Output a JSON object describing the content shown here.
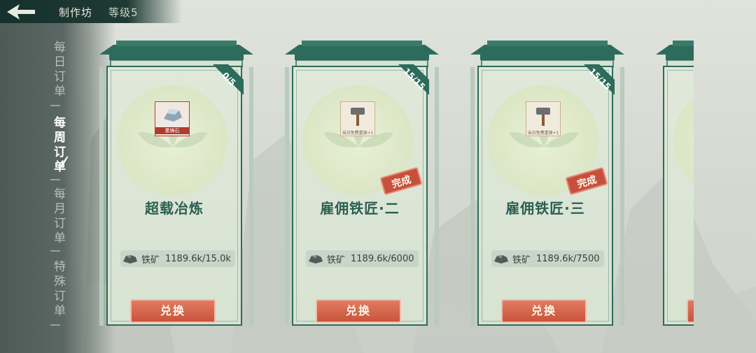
{
  "header": {
    "title": "制作坊",
    "level": "等级5"
  },
  "nav": {
    "tabs": [
      {
        "label": "每日订单",
        "active": false
      },
      {
        "label": "每周订单",
        "active": true
      },
      {
        "label": "每月订单",
        "active": false
      },
      {
        "label": "特殊订单",
        "active": false
      }
    ]
  },
  "cards": [
    {
      "progress": "0/5",
      "item_icon": "iron-ingot-icon",
      "item_caption": "重铸石",
      "name": "超载冶炼",
      "completed": false,
      "stamp": "",
      "cost_resource": "铁矿",
      "cost_amount": "1189.6k/15.0k",
      "button": "兑换"
    },
    {
      "progress": "15/15",
      "item_icon": "hammer-icon",
      "item_caption": "当日免费重铸+1",
      "name": "雇佣铁匠·二",
      "completed": true,
      "stamp": "完成",
      "cost_resource": "铁矿",
      "cost_amount": "1189.6k/6000",
      "button": "兑换"
    },
    {
      "progress": "15/15",
      "item_icon": "hammer-icon",
      "item_caption": "当日免费重铸+1",
      "name": "雇佣铁匠·三",
      "completed": true,
      "stamp": "完成",
      "cost_resource": "铁矿",
      "cost_amount": "1189.6k/7500",
      "button": "兑换"
    }
  ],
  "colors": {
    "accent": "#2d6b5c",
    "button": "#c8543b",
    "stamp": "#c7503d"
  }
}
